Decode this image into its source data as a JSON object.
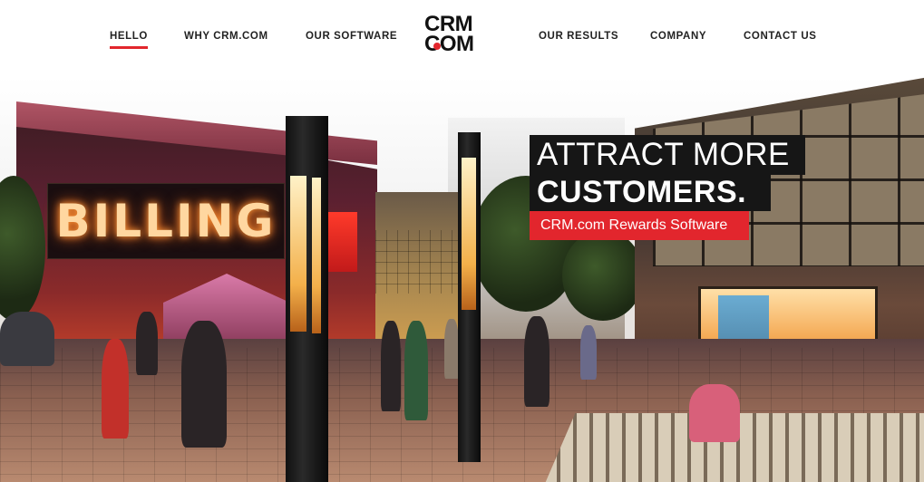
{
  "nav": {
    "left": [
      {
        "label": "HELLO",
        "active": true
      },
      {
        "label": "WHY CRM.COM",
        "active": false
      },
      {
        "label": "OUR SOFTWARE",
        "active": false
      }
    ],
    "right": [
      {
        "label": "OUR RESULTS",
        "active": false
      },
      {
        "label": "COMPANY",
        "active": false
      },
      {
        "label": "CONTACT US",
        "active": false
      }
    ],
    "accent_color": "#e2262d"
  },
  "logo": {
    "line1": "CRM",
    "line2": "COM"
  },
  "hero": {
    "headline_line1": "ATTRACT MORE",
    "headline_line2": "CUSTOMERS.",
    "tagline": "CRM.com Rewards Software",
    "billboard_text": "BILLING",
    "headline_bg": "#161616",
    "tagline_bg": "#e2262d"
  }
}
